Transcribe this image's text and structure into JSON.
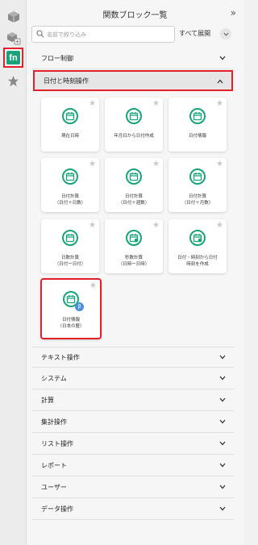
{
  "panel": {
    "title": "関数ブロック一覧",
    "collapse": "»",
    "search_placeholder": "名前で絞り込み",
    "expand_all": "すべて展開"
  },
  "categories": [
    {
      "label": "フロー制御"
    },
    {
      "label": "日付と時刻操作"
    },
    {
      "label": "テキスト操作"
    },
    {
      "label": "システム"
    },
    {
      "label": "計算"
    },
    {
      "label": "集計操作"
    },
    {
      "label": "リスト操作"
    },
    {
      "label": "レポート"
    },
    {
      "label": "ユーザー"
    },
    {
      "label": "データ操作"
    }
  ],
  "blocks": [
    {
      "line1": "現在日時",
      "line2": ""
    },
    {
      "line1": "年月日から日付作成",
      "line2": ""
    },
    {
      "line1": "日付情報",
      "line2": ""
    },
    {
      "line1": "日付計算",
      "line2": "（日付＋日数）"
    },
    {
      "line1": "日付計算",
      "line2": "（日付＋週数）"
    },
    {
      "line1": "日付計算",
      "line2": "（日付＋月数）"
    },
    {
      "line1": "日数計算",
      "line2": "（日付ー日付）"
    },
    {
      "line1": "秒数計算",
      "line2": "（日時ー日時）"
    },
    {
      "line1": "日付・時刻から日付",
      "line2": "時刻を作成"
    },
    {
      "line1": "日付情報",
      "line2": "（日本の暦）"
    }
  ],
  "beta_badge": "β",
  "colors": {
    "accent": "#1aa37a",
    "highlight": "#e41e2b"
  }
}
